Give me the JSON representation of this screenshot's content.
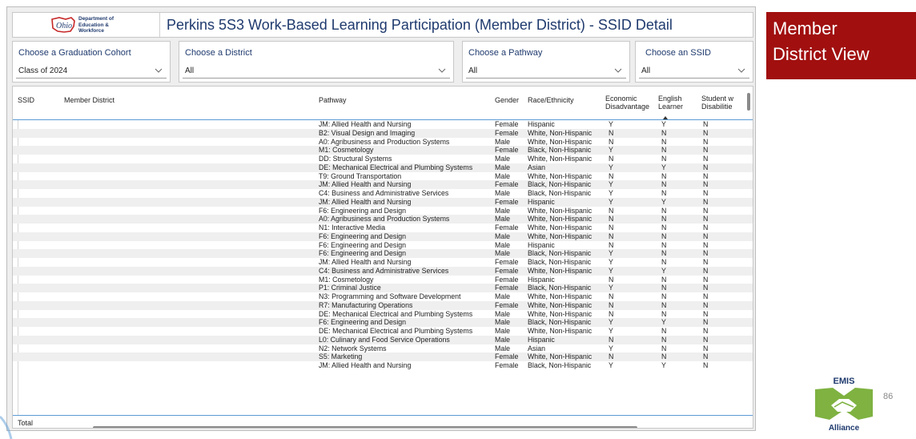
{
  "header": {
    "logo_lines": [
      "Department of",
      "Education &",
      "Workforce"
    ],
    "title": "Perkins 5S3 Work-Based Learning Participation (Member District) - SSID Detail"
  },
  "filters": [
    {
      "label": "Choose a Graduation Cohort",
      "value": "Class of 2024"
    },
    {
      "label": "Choose a District",
      "value": "All"
    },
    {
      "label": "Choose a Pathway",
      "value": "All"
    },
    {
      "label": "Choose an SSID",
      "value": "All"
    }
  ],
  "table": {
    "columns": {
      "ssid": "SSID",
      "district": "Member District",
      "pathway": "Pathway",
      "gender": "Gender",
      "race": "Race/Ethnicity",
      "econ": "Economic Disadvantage",
      "el": "English Learner",
      "swd": "Student w Disabilitie"
    },
    "rows": [
      [
        "JM: Allied Health and Nursing",
        "Female",
        "Hispanic",
        "Y",
        "Y",
        "N"
      ],
      [
        "B2: Visual Design and Imaging",
        "Female",
        "White, Non-Hispanic",
        "N",
        "N",
        "N"
      ],
      [
        "A0: Agribusiness and Production Systems",
        "Male",
        "White, Non-Hispanic",
        "N",
        "N",
        "N"
      ],
      [
        "M1: Cosmetology",
        "Female",
        "Black, Non-Hispanic",
        "Y",
        "N",
        "N"
      ],
      [
        "DD: Structural Systems",
        "Male",
        "White, Non-Hispanic",
        "N",
        "N",
        "N"
      ],
      [
        "DE: Mechanical Electrical and Plumbing Systems",
        "Male",
        "Asian",
        "Y",
        "Y",
        "N"
      ],
      [
        "T9: Ground Transportation",
        "Male",
        "White, Non-Hispanic",
        "N",
        "N",
        "N"
      ],
      [
        "JM: Allied Health and Nursing",
        "Female",
        "Black, Non-Hispanic",
        "Y",
        "N",
        "N"
      ],
      [
        "C4: Business and Administrative Services",
        "Male",
        "Black, Non-Hispanic",
        "Y",
        "N",
        "N"
      ],
      [
        "JM: Allied Health and Nursing",
        "Female",
        "Hispanic",
        "Y",
        "Y",
        "N"
      ],
      [
        "F6: Engineering and Design",
        "Male",
        "White, Non-Hispanic",
        "N",
        "N",
        "N"
      ],
      [
        "A0: Agribusiness and Production Systems",
        "Male",
        "White, Non-Hispanic",
        "N",
        "N",
        "N"
      ],
      [
        "N1: Interactive Media",
        "Female",
        "White, Non-Hispanic",
        "N",
        "N",
        "N"
      ],
      [
        "F6: Engineering and Design",
        "Male",
        "White, Non-Hispanic",
        "N",
        "N",
        "N"
      ],
      [
        "F6: Engineering and Design",
        "Male",
        "Hispanic",
        "N",
        "N",
        "N"
      ],
      [
        "F6: Engineering and Design",
        "Male",
        "Black, Non-Hispanic",
        "Y",
        "N",
        "N"
      ],
      [
        "JM: Allied Health and Nursing",
        "Female",
        "Black, Non-Hispanic",
        "Y",
        "N",
        "N"
      ],
      [
        "C4: Business and Administrative Services",
        "Female",
        "White, Non-Hispanic",
        "Y",
        "Y",
        "N"
      ],
      [
        "M1: Cosmetology",
        "Female",
        "Hispanic",
        "N",
        "N",
        "N"
      ],
      [
        "P1: Criminal Justice",
        "Female",
        "Black, Non-Hispanic",
        "Y",
        "N",
        "N"
      ],
      [
        "N3: Programming and Software Development",
        "Male",
        "White, Non-Hispanic",
        "N",
        "N",
        "N"
      ],
      [
        "R7: Manufacturing Operations",
        "Female",
        "White, Non-Hispanic",
        "N",
        "N",
        "N"
      ],
      [
        "DE: Mechanical Electrical and Plumbing Systems",
        "Male",
        "White, Non-Hispanic",
        "N",
        "N",
        "N"
      ],
      [
        "F6: Engineering and Design",
        "Male",
        "Black, Non-Hispanic",
        "Y",
        "Y",
        "N"
      ],
      [
        "DE: Mechanical Electrical and Plumbing Systems",
        "Male",
        "White, Non-Hispanic",
        "Y",
        "N",
        "N"
      ],
      [
        "L0: Culinary and Food Service Operations",
        "Male",
        "Hispanic",
        "N",
        "N",
        "N"
      ],
      [
        "N2: Network Systems",
        "Male",
        "Asian",
        "Y",
        "N",
        "N"
      ],
      [
        "S5: Marketing",
        "Female",
        "White, Non-Hispanic",
        "N",
        "N",
        "N"
      ],
      [
        "JM: Allied Health and Nursing",
        "Female",
        "Black, Non-Hispanic",
        "Y",
        "Y",
        "N"
      ]
    ],
    "total_label": "Total"
  },
  "side_badge": {
    "lines": [
      "Member",
      "District View"
    ]
  },
  "footer": {
    "logo_top": "EMIS",
    "logo_bottom": "Alliance",
    "page_number": "86"
  },
  "colors": {
    "title_blue": "#1f3a6e",
    "badge_red": "#a10f0f",
    "emis_green": "#7fb241",
    "rule_blue": "#5b9bd5"
  }
}
